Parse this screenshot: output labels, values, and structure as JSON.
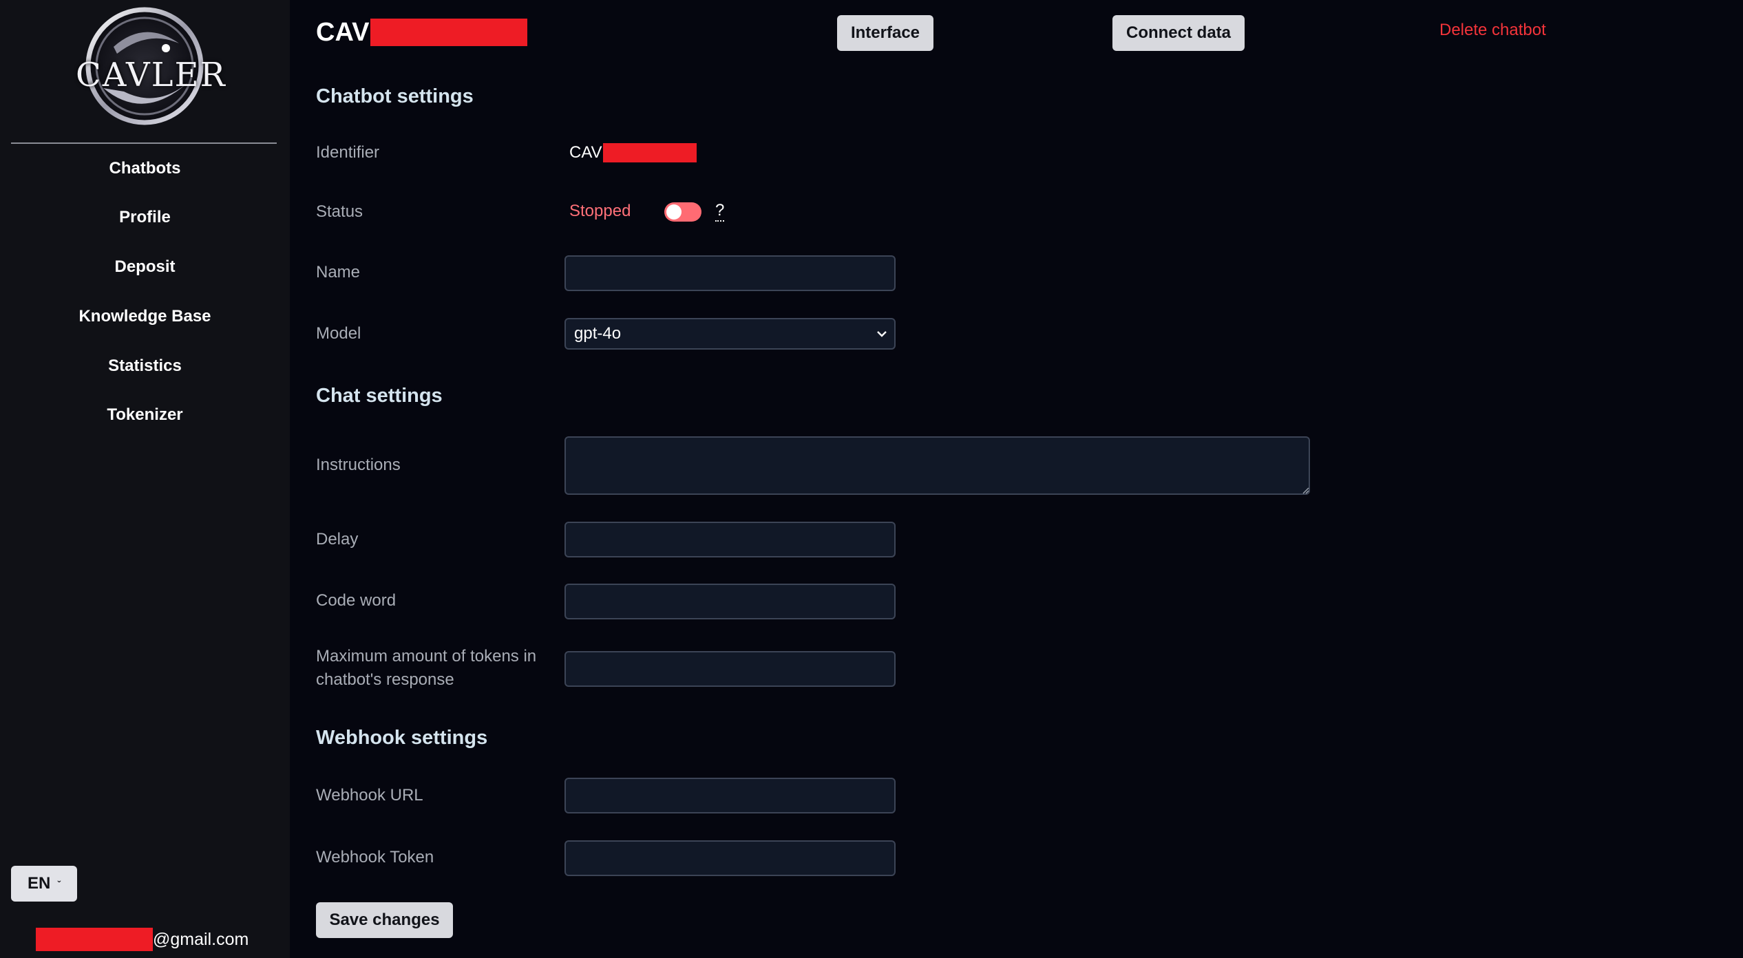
{
  "brand": {
    "logo_text": "CAVLER"
  },
  "sidebar": {
    "items": [
      {
        "label": "Chatbots"
      },
      {
        "label": "Profile"
      },
      {
        "label": "Deposit"
      },
      {
        "label": "Knowledge Base"
      },
      {
        "label": "Statistics"
      },
      {
        "label": "Tokenizer"
      }
    ],
    "language": "EN",
    "user_email_suffix": "@gmail.com"
  },
  "header": {
    "title_prefix": "CAV",
    "interface_button": "Interface",
    "connect_data_button": "Connect data",
    "delete_link": "Delete chatbot"
  },
  "chatbot_settings": {
    "title": "Chatbot settings",
    "identifier_label": "Identifier",
    "identifier_prefix": "CAV",
    "status_label": "Status",
    "status_value": "Stopped",
    "status_help": "?",
    "name_label": "Name",
    "name_value": "",
    "model_label": "Model",
    "model_value": "gpt-4o"
  },
  "chat_settings": {
    "title": "Chat settings",
    "instructions_label": "Instructions",
    "instructions_value": "",
    "delay_label": "Delay",
    "delay_value": "",
    "code_word_label": "Code word",
    "code_word_value": "",
    "max_tokens_label": "Maximum amount of tokens in chatbot's response",
    "max_tokens_value": ""
  },
  "webhook_settings": {
    "title": "Webhook settings",
    "url_label": "Webhook URL",
    "url_value": "",
    "token_label": "Webhook Token",
    "token_value": ""
  },
  "actions": {
    "save_button": "Save changes"
  },
  "colors": {
    "background": "#05060f",
    "sidebar": "#101116",
    "accent_red": "#f4343a",
    "status_red": "#ff7078",
    "input_bg": "#111827"
  }
}
